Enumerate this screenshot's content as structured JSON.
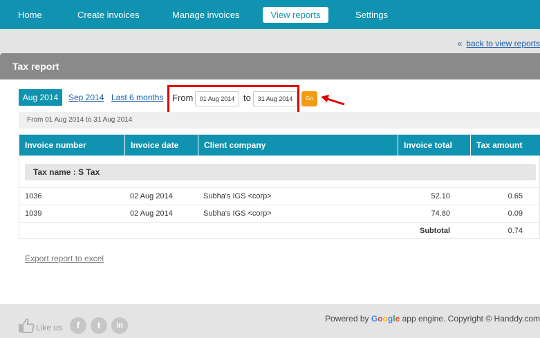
{
  "nav": {
    "items": [
      {
        "label": "Home"
      },
      {
        "label": "Create invoices"
      },
      {
        "label": "Manage invoices"
      },
      {
        "label": "View reports"
      },
      {
        "label": "Settings"
      }
    ],
    "active_index": 3
  },
  "back_link": {
    "arrow": "«",
    "label": "back to view reports"
  },
  "panel": {
    "title": "Tax report"
  },
  "periods": [
    {
      "label": "Aug 2014",
      "active": true
    },
    {
      "label": "Sep 2014",
      "active": false
    },
    {
      "label": "Last 6 months",
      "active": false
    }
  ],
  "range": {
    "from_label": "From",
    "from_value": "01 Aug 2014",
    "to_label": "to",
    "to_value": "31 Aug 2014",
    "go_label": "Go",
    "summary": "From 01 Aug 2014 to 31 Aug 2014"
  },
  "table": {
    "headers": [
      "Invoice number",
      "Invoice date",
      "Client company",
      "Invoice total",
      "Tax amount"
    ],
    "tax_name": "Tax name : S Tax",
    "rows": [
      {
        "number": "1036",
        "date": "02 Aug 2014",
        "client": "Subha's IGS <corp>",
        "total": "52.10",
        "tax": "0.65"
      },
      {
        "number": "1039",
        "date": "02 Aug 2014",
        "client": "Subha's IGS <corp>",
        "total": "74.80",
        "tax": "0.09"
      }
    ],
    "subtotal_label": "Subtotal",
    "subtotal_value": "0.74"
  },
  "export_label": "Export report to excel",
  "footer": {
    "like_text": "Like us",
    "social": [
      {
        "glyph": "f",
        "icon": "facebook-icon"
      },
      {
        "glyph": "t",
        "icon": "twitter-icon"
      },
      {
        "glyph": "in",
        "icon": "linkedin-icon"
      }
    ],
    "powered_prefix": "Powered by",
    "google": [
      "G",
      "o",
      "o",
      "g",
      "l",
      "e"
    ],
    "powered_suffix": "app engine. Copyright © Handdy.com"
  },
  "colors": {
    "brand": "#0f93b0",
    "go": "#f39c12",
    "highlight": "#e00000"
  }
}
